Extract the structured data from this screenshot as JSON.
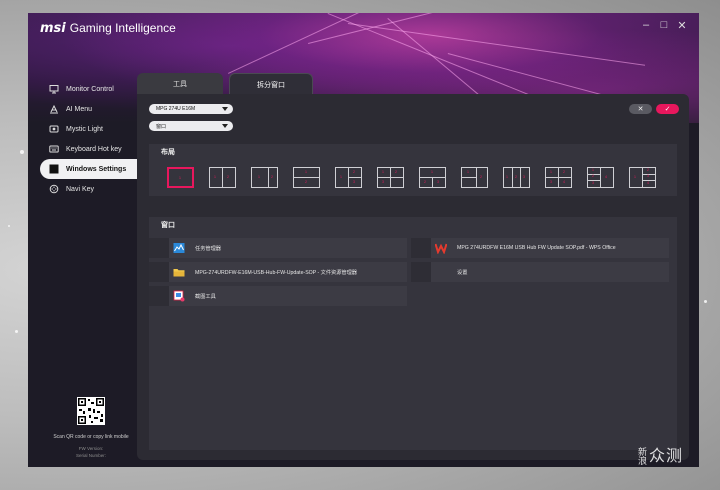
{
  "app": {
    "brand": "msi",
    "title": "Gaming Intelligence"
  },
  "window_controls": [
    "–",
    "□",
    "✕"
  ],
  "sidebar": {
    "items": [
      {
        "label": "Monitor Control",
        "icon": "monitor-icon",
        "active": false
      },
      {
        "label": "AI Menu",
        "icon": "ai-menu-icon",
        "active": false
      },
      {
        "label": "Mystic Light",
        "icon": "light-icon",
        "active": false
      },
      {
        "label": "Keyboard Hot key",
        "icon": "keyboard-icon",
        "active": false
      },
      {
        "label": "Windows Settings",
        "icon": "windows-icon",
        "active": true
      },
      {
        "label": "Navi Key",
        "icon": "navi-key-icon",
        "active": false
      }
    ],
    "qr_caption": "Scan QR code or copy link mobile",
    "fw_version": "FW Version:",
    "serial_number": "Serial Number:"
  },
  "tabs": [
    {
      "label": "工具",
      "active": false
    },
    {
      "label": "拆分窗口",
      "active": true
    }
  ],
  "toolbar": {
    "monitor_select": "MPG 274U E16M",
    "window_select": "窗口",
    "cancel_label": "✕",
    "confirm_label": "✓"
  },
  "layout_section": {
    "title": "布局",
    "options": 12,
    "selected_index": 0
  },
  "window_section": {
    "title": "窗口",
    "items": [
      {
        "label": "任务管理器",
        "icon": "task-manager-icon"
      },
      {
        "label": "MPG 274URDFW E16M USB Hub FW Update SOP.pdf - WPS Office",
        "icon": "wps-icon"
      },
      {
        "label": "MPG-274URDFW-E16M-USB-Hub-FW-Update-SOP - 文件资源管理器",
        "icon": "folder-icon"
      },
      {
        "label": "设置",
        "icon": "settings-icon"
      },
      {
        "label": "截图工具",
        "icon": "snipping-tool-icon"
      }
    ]
  },
  "watermark": {
    "text_small": "新浪",
    "text_large": "众测"
  },
  "colors": {
    "accent": "#e8175d",
    "panel": "#2c2b33",
    "section": "#35343d"
  }
}
